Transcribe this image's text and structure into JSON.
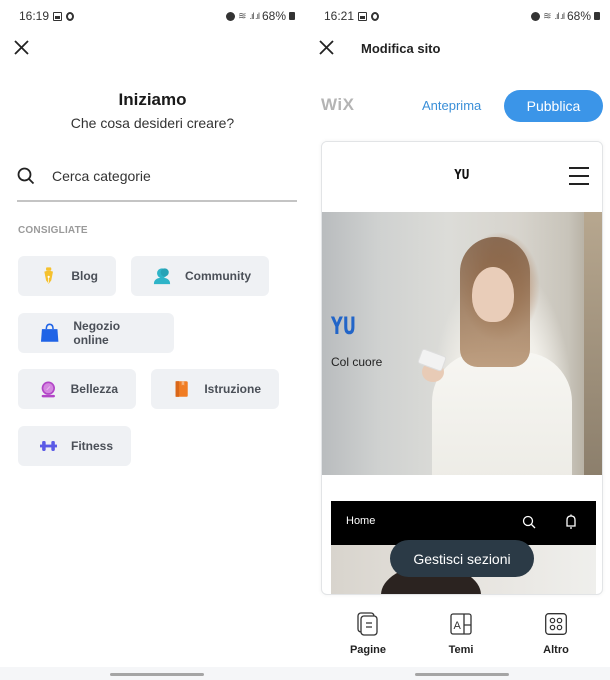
{
  "left_screen": {
    "status_bar": {
      "time": "16:19",
      "battery": "68%"
    },
    "title": "Iniziamo",
    "subtitle": "Che cosa desideri creare?",
    "search": {
      "placeholder": "Cerca categorie",
      "value": ""
    },
    "section_label": "CONSIGLIATE",
    "categories": [
      {
        "label": "Blog",
        "icon": "pen-nib-icon",
        "color": "#f5c12e"
      },
      {
        "label": "Community",
        "icon": "people-icon",
        "color": "#2eb4c8"
      },
      {
        "label": "Negozio online",
        "icon": "shopping-bag-icon",
        "color": "#1f63e6"
      },
      {
        "label": "Bellezza",
        "icon": "mirror-icon",
        "color": "#b245c7"
      },
      {
        "label": "Istruzione",
        "icon": "book-icon",
        "color": "#f07c22"
      },
      {
        "label": "Fitness",
        "icon": "dumbbell-icon",
        "color": "#5b5be6"
      }
    ]
  },
  "right_screen": {
    "status_bar": {
      "time": "16:21",
      "battery": "68%"
    },
    "title": "Modifica sito",
    "logo": "WiX",
    "preview_label": "Anteprima",
    "publish_label": "Pubblica",
    "accent_color": "#3b95e8",
    "site_preview": {
      "logo": "YU",
      "hero_title": "YU",
      "hero_subtitle": "Col cuore",
      "nav_home": "Home"
    },
    "manage_sections_label": "Gestisci sezioni",
    "bottom_tabs": [
      {
        "label": "Pagine",
        "icon": "pages-icon"
      },
      {
        "label": "Temi",
        "icon": "themes-icon"
      },
      {
        "label": "Altro",
        "icon": "grid-icon"
      }
    ]
  }
}
